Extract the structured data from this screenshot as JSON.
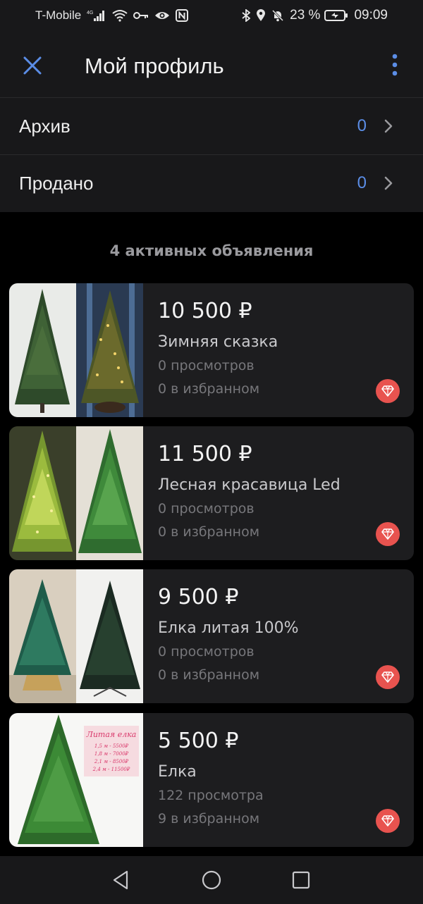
{
  "status_bar": {
    "carrier": "T-Mobile",
    "network": "4G",
    "battery_percent": "23 %",
    "time": "09:09",
    "left_icons": [
      "signal-icon",
      "wifi-icon",
      "key-icon",
      "eye-icon",
      "nfc-icon"
    ],
    "right_icons": [
      "bluetooth-icon",
      "location-icon",
      "mute-bell-icon",
      "battery-icon"
    ]
  },
  "header": {
    "title": "Мой профиль",
    "close_icon": "close-icon",
    "menu_icon": "more-vertical-icon"
  },
  "rows": [
    {
      "label": "Архив",
      "count": "0"
    },
    {
      "label": "Продано",
      "count": "0"
    }
  ],
  "section_title": "4 активных объявления",
  "listings": [
    {
      "price": "10 500 ₽",
      "title": "Зимняя сказка",
      "views": "0 просмотров",
      "favorites": "0 в избранном",
      "badge_icon": "diamond-icon"
    },
    {
      "price": "11 500 ₽",
      "title": "Лесная красавица Led",
      "views": "0 просмотров",
      "favorites": "0 в избранном",
      "badge_icon": "diamond-icon"
    },
    {
      "price": "9 500 ₽",
      "title": "Елка литая 100%",
      "views": "0 просмотров",
      "favorites": "0 в избранном",
      "badge_icon": "diamond-icon"
    },
    {
      "price": "5 500 ₽",
      "title": "Елка",
      "views": "122 просмотра",
      "favorites": "9 в избранном",
      "badge_icon": "diamond-icon",
      "photo_sign": {
        "title": "Литая елка",
        "lines": [
          "1,5 м - 5500₽",
          "1,8 м - 7000₽",
          "2,1 м - 8500₽",
          "2,4 м - 11500₽"
        ]
      }
    }
  ],
  "nav": {
    "back_icon": "back-triangle-icon",
    "home_icon": "home-circle-icon",
    "recents_icon": "recents-square-icon"
  },
  "colors": {
    "background": "#000000",
    "surface": "#18181a",
    "card": "#1d1d1f",
    "accent": "#5b8de6",
    "badge": "#e8534f"
  }
}
